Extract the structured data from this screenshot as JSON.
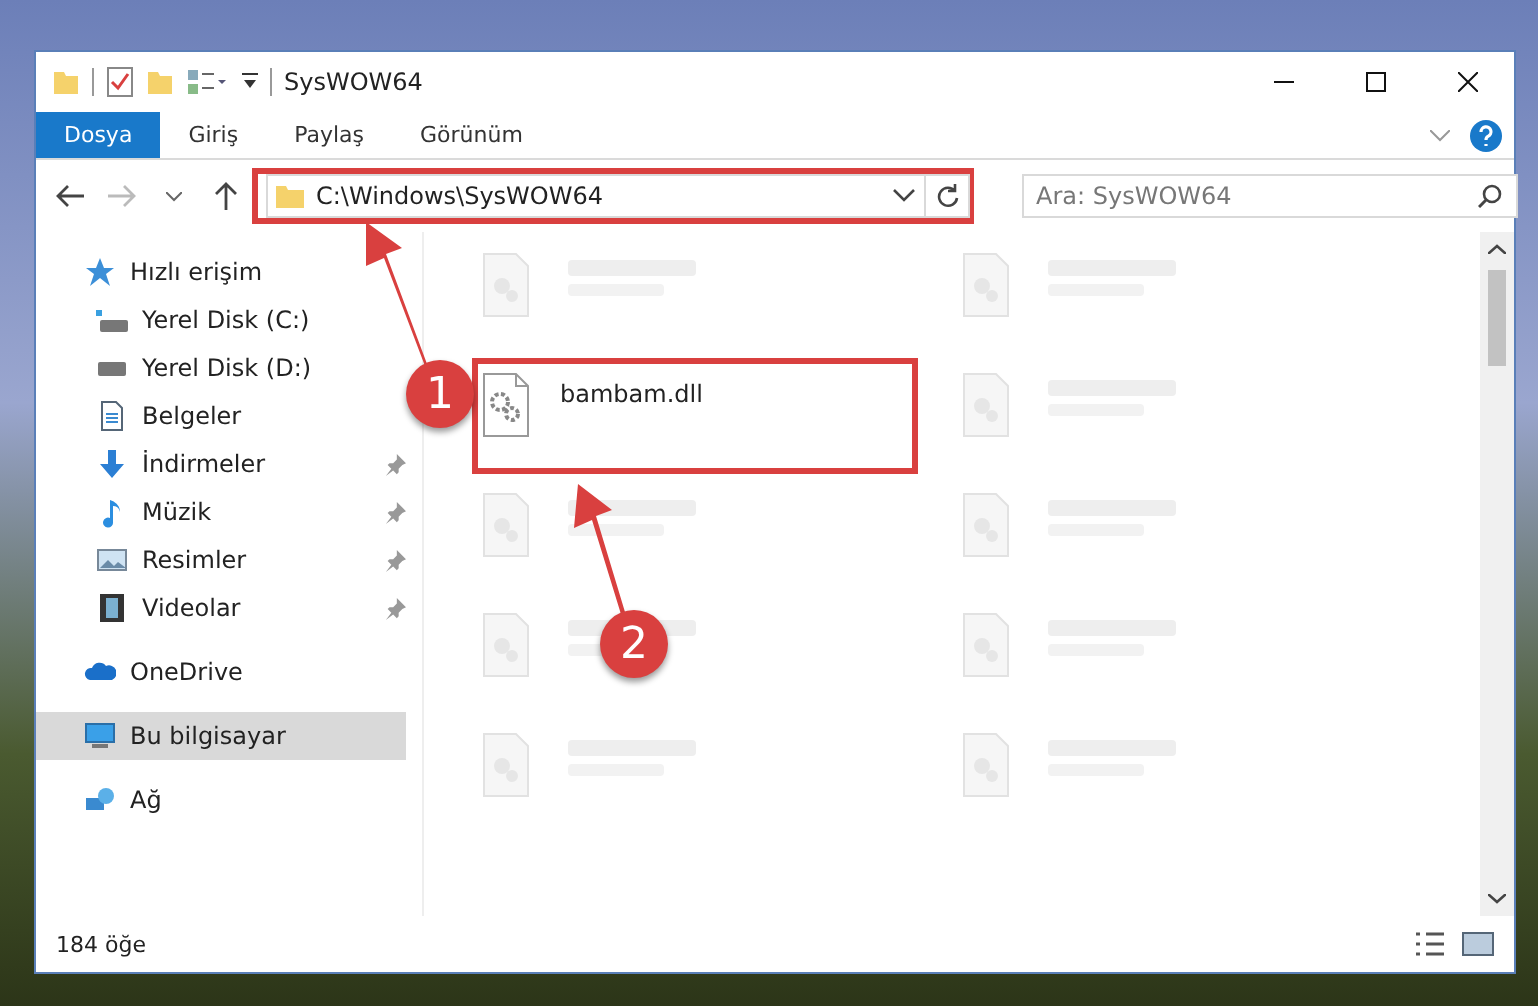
{
  "window": {
    "title": "SysWOW64"
  },
  "ribbon_tabs": [
    {
      "label": "Dosya",
      "selected": true
    },
    {
      "label": "Giriş",
      "selected": false
    },
    {
      "label": "Paylaş",
      "selected": false
    },
    {
      "label": "Görünüm",
      "selected": false
    }
  ],
  "address_bar": {
    "path": "C:\\Windows\\SysWOW64",
    "highlighted": true
  },
  "search": {
    "placeholder": "Ara: SysWOW64"
  },
  "sidebar": {
    "items": [
      {
        "label": "Hızlı erişim",
        "kind": "star",
        "selected": false,
        "children": [
          {
            "label": "Yerel Disk (C:)",
            "kind": "drive-c",
            "selected": false,
            "pinned": false
          },
          {
            "label": "Yerel Disk (D:)",
            "kind": "drive",
            "selected": false,
            "pinned": false
          },
          {
            "label": "Belgeler",
            "kind": "documents",
            "selected": false,
            "pinned": false
          },
          {
            "label": "İndirmeler",
            "kind": "downloads",
            "selected": false,
            "pinned": true
          },
          {
            "label": "Müzik",
            "kind": "music",
            "selected": false,
            "pinned": true
          },
          {
            "label": "Resimler",
            "kind": "pictures",
            "selected": false,
            "pinned": true
          },
          {
            "label": "Videolar",
            "kind": "videos",
            "selected": false,
            "pinned": true
          }
        ]
      },
      {
        "label": "OneDrive",
        "kind": "cloud",
        "selected": false
      },
      {
        "label": "Bu bilgisayar",
        "kind": "computer",
        "selected": true
      },
      {
        "label": "Ağ",
        "kind": "network",
        "selected": false
      }
    ]
  },
  "files": [
    {
      "blurred": true
    },
    {
      "blurred": true
    },
    {
      "name": "bambam.dll",
      "blurred": false,
      "highlighted": true
    },
    {
      "blurred": true
    },
    {
      "blurred": true
    },
    {
      "blurred": true
    },
    {
      "blurred": true
    },
    {
      "blurred": true
    },
    {
      "blurred": true
    },
    {
      "blurred": true
    }
  ],
  "status_bar": {
    "item_count": "184 öğe"
  },
  "annotations": [
    {
      "label": "1"
    },
    {
      "label": "2"
    }
  ]
}
